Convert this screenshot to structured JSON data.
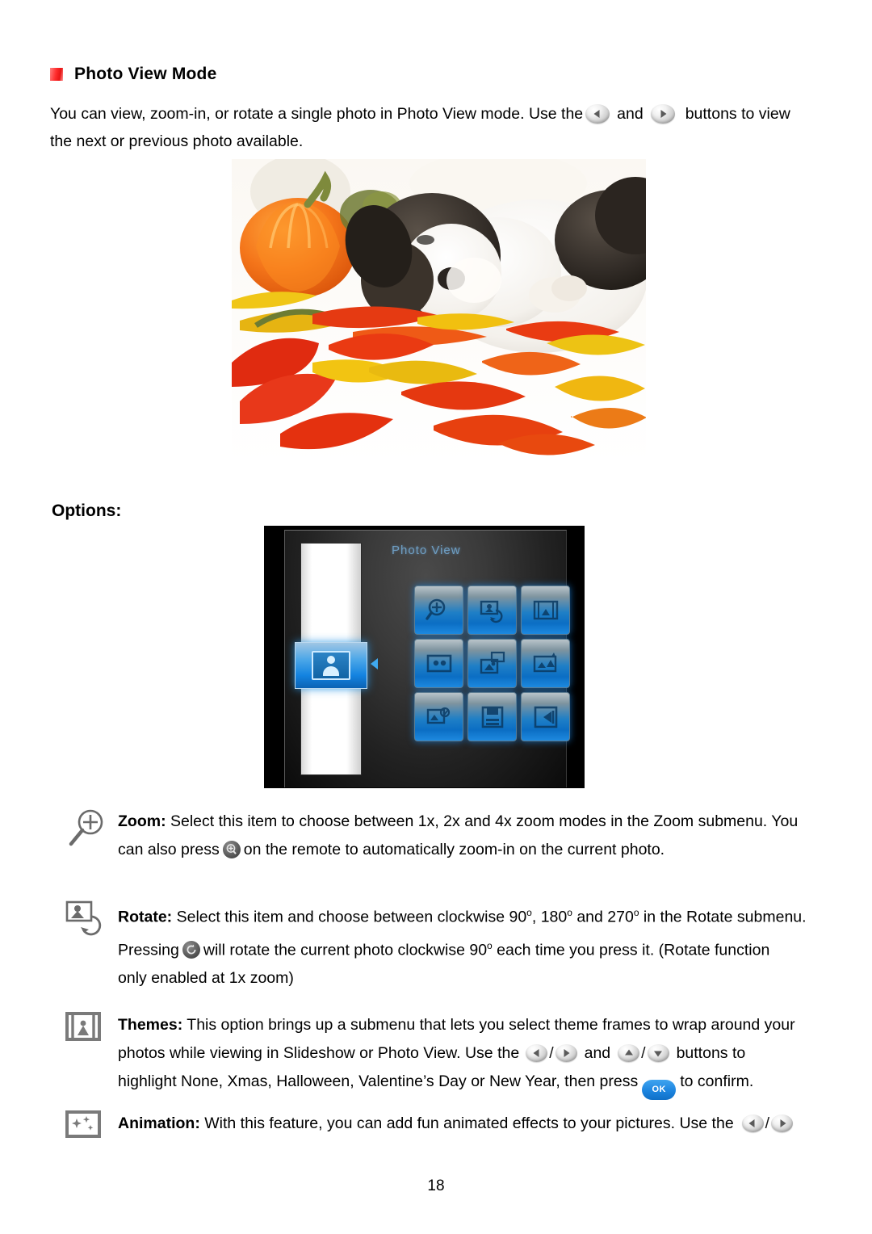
{
  "heading": {
    "bullet_color": "#ff2d2d",
    "title": "Photo View Mode"
  },
  "intro": {
    "line1_a": "You can view, zoom-in, or rotate a single photo in Photo View mode. Use the",
    "line1_b": "and",
    "line1_c": "buttons to view",
    "line2": "the next or previous photo available."
  },
  "photo": {
    "alt": "Black and white puppy lying on autumn leaves beside an orange pumpkin"
  },
  "options_label": "Options:",
  "device": {
    "title": "Photo View",
    "sidebar_icon": "photo-portrait-icon",
    "grid_icons": [
      "zoom-magnifier-icon",
      "rotate-photo-icon",
      "themes-frame-icon",
      "slideshow-icon",
      "copy-photo-icon",
      "animation-icon",
      "effects-icon",
      "save-icon",
      "exit-back-icon"
    ]
  },
  "options": [
    {
      "icon": "zoom-magnifier-plus-icon",
      "lead": "Zoom:",
      "line1": "Select this item to choose between 1x, 2x and 4x zoom modes in the Zoom submenu. You",
      "line2_a": "can also press",
      "line2_b": "on the remote to automatically zoom-in on the current photo."
    },
    {
      "icon": "rotate-photo-icon",
      "lead": "Rotate:",
      "line1_a": "Select this item and choose between clockwise 90",
      "line1_b": ", 180",
      "line1_c": " and 270",
      "line1_d": " in the Rotate submenu.",
      "line2_a": "Pressing",
      "line2_b": "will rotate the current photo clockwise 90",
      "line2_c": " each time you press it. (Rotate function",
      "line3": "only enabled at 1x zoom)"
    },
    {
      "icon": "themes-frame-icon",
      "lead": "Themes:",
      "line1": "This option brings up a submenu that lets you select theme frames to wrap around your",
      "line2_a": "photos while viewing in Slideshow or Photo View. Use the",
      "line2_b": "and",
      "line2_c": "buttons to",
      "line3_a": "highlight None, Xmas, Halloween, Valentine’s Day or New Year, then press",
      "line3_ok": "OK",
      "line3_b": "to confirm."
    },
    {
      "icon": "animation-stars-icon",
      "lead": "Animation:",
      "line1_a": "With this feature, you can add fun animated effects to your pictures. Use the"
    }
  ],
  "page_number": "18"
}
